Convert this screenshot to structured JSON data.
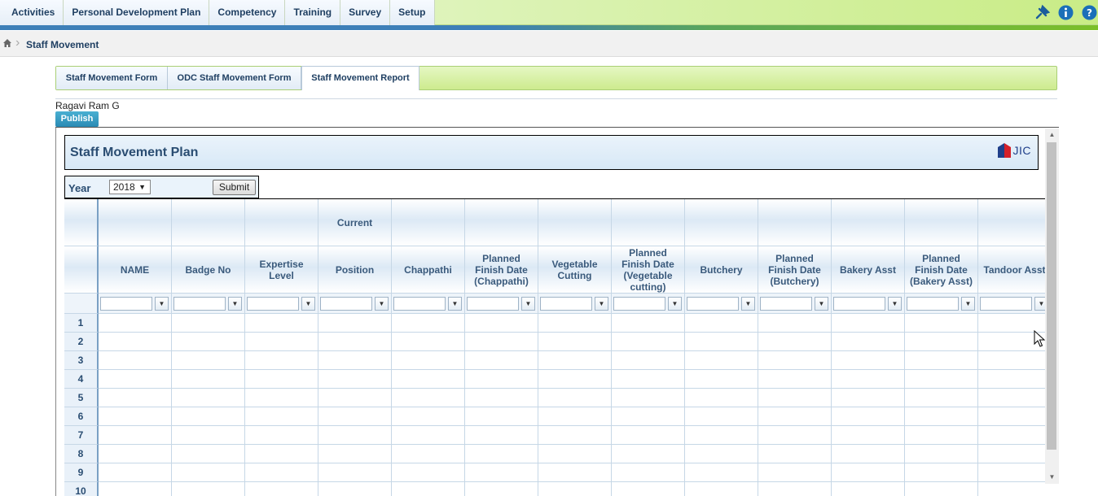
{
  "menu": {
    "items": [
      "Activities",
      "Personal Development Plan",
      "Competency",
      "Training",
      "Survey",
      "Setup"
    ]
  },
  "top_icons": [
    "pin-icon",
    "info-icon",
    "help-icon"
  ],
  "breadcrumb": {
    "current": "Staff Movement"
  },
  "tabs": [
    {
      "label": "Staff Movement Form",
      "active": false
    },
    {
      "label": "ODC Staff Movement Form",
      "active": false
    },
    {
      "label": "Staff Movement Report",
      "active": true
    }
  ],
  "user": {
    "name": "Ragavi Ram G"
  },
  "publish_label": "Publish",
  "report": {
    "title": "Staff Movement Plan",
    "logo_text": "JIC",
    "year_label": "Year",
    "year_value": "2018",
    "submit_label": "Submit"
  },
  "grid": {
    "group_header": "Current",
    "columns": [
      "NAME",
      "Badge No",
      "Expertise Level",
      "Position",
      "Chappathi",
      "Planned Finish Date (Chappathi)",
      "Vegetable Cutting",
      "Planned Finish Date (Vegetable cutting)",
      "Butchery",
      "Planned Finish Date (Butchery)",
      "Bakery Asst",
      "Planned Finish Date (Bakery Asst)",
      "Tandoor Asst"
    ],
    "row_numbers": [
      "1",
      "2",
      "3",
      "4",
      "5",
      "6",
      "7",
      "8",
      "9",
      "10"
    ]
  },
  "colors": {
    "menu_text": "#1f3f62",
    "accent_green": "#7cbf2a",
    "accent_blue": "#3d7fb8",
    "publish_button": "#2a8ab4",
    "header_title": "#2a4d72"
  }
}
